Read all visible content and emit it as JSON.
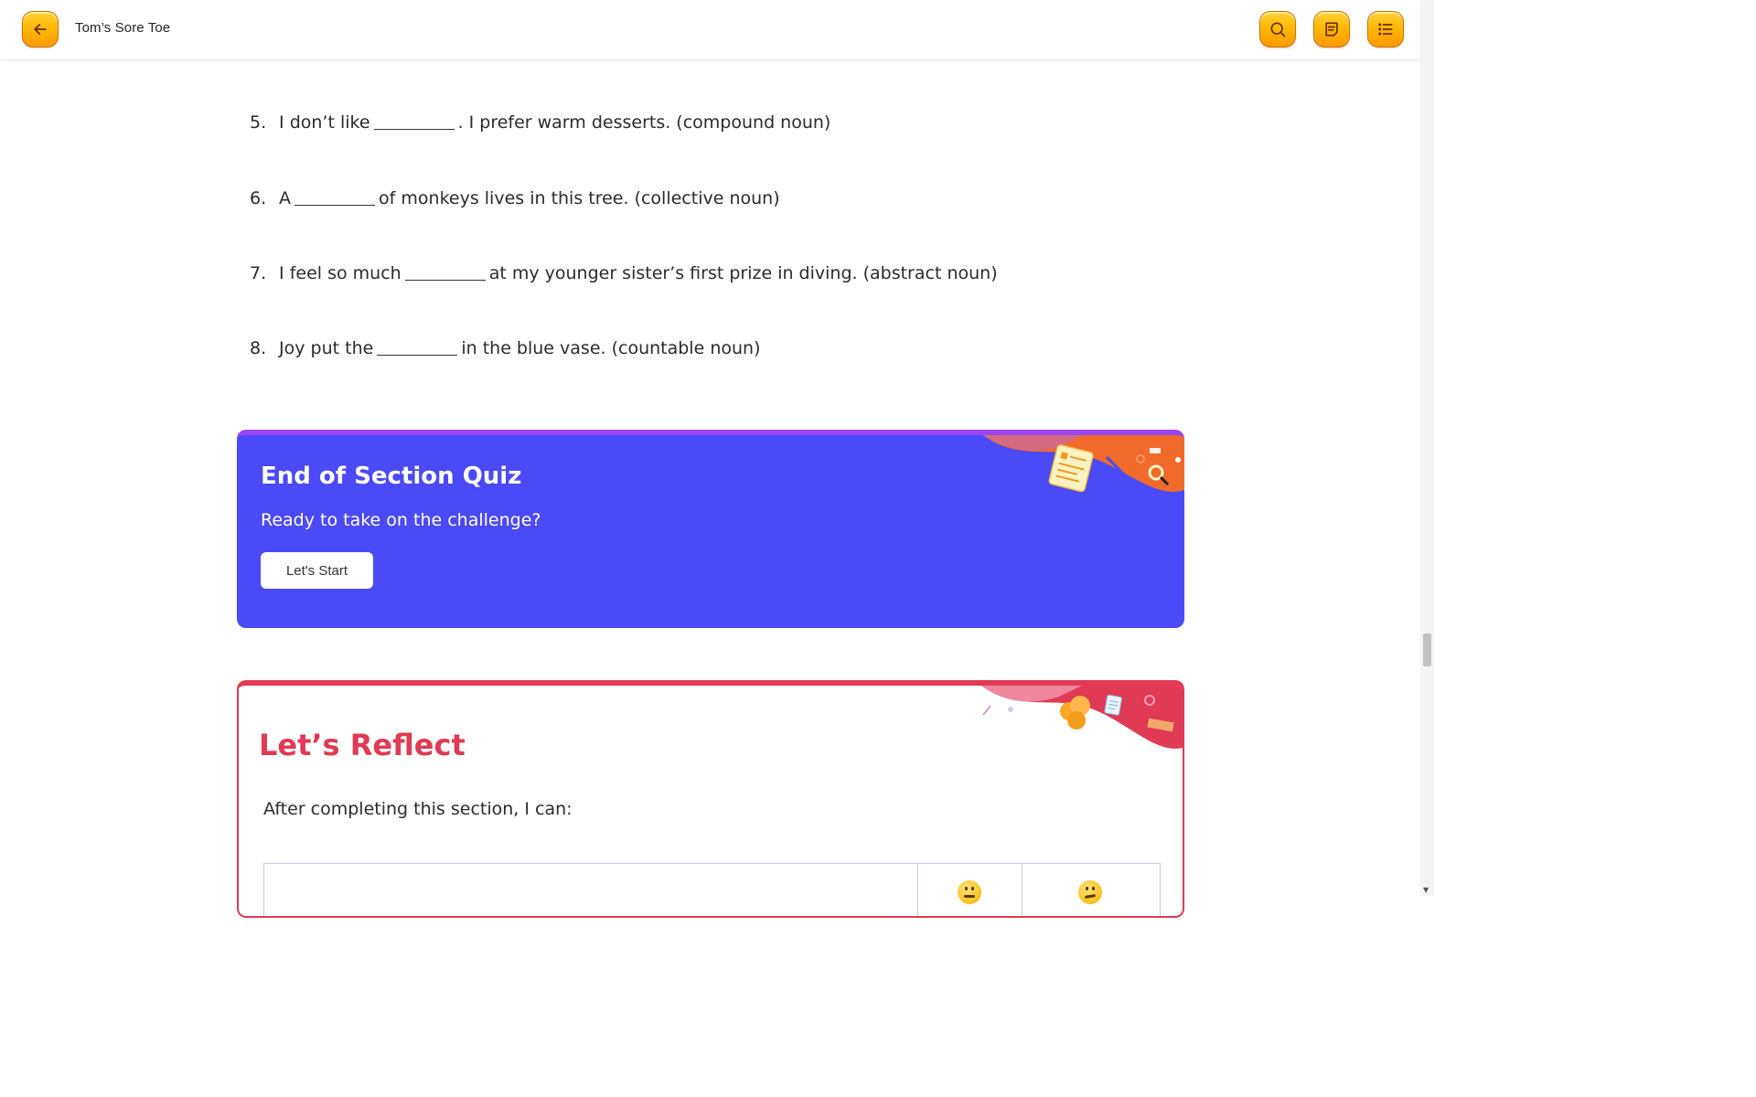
{
  "header": {
    "book_title": "Tom’s Sore Toe",
    "icons": {
      "back": "arrow-left-icon",
      "search": "search-icon",
      "notes": "notes-icon",
      "toc": "list-icon"
    }
  },
  "exercise": {
    "items": [
      {
        "number": "5.",
        "before": "I don’t like",
        "after": ". I prefer warm desserts. (compound noun)"
      },
      {
        "number": "6.",
        "before": "A",
        "after": "of monkeys lives in this tree. (collective noun)"
      },
      {
        "number": "7.",
        "before": "I feel so much",
        "after": "at my younger sister’s first prize in diving. (abstract noun)"
      },
      {
        "number": "8.",
        "before": "Joy put the",
        "after": "in the blue vase. (countable noun)"
      }
    ]
  },
  "quiz": {
    "title": "End of Section Quiz",
    "subtitle": "Ready to take on the challenge?",
    "button_label": "Let's Start",
    "colors": {
      "background": "#4a4af8",
      "accent": "#9b45f2"
    }
  },
  "reflect": {
    "title": "Let’s Reflect",
    "intro": "After completing this section, I can:",
    "colors": {
      "accent": "#e03a54"
    }
  }
}
